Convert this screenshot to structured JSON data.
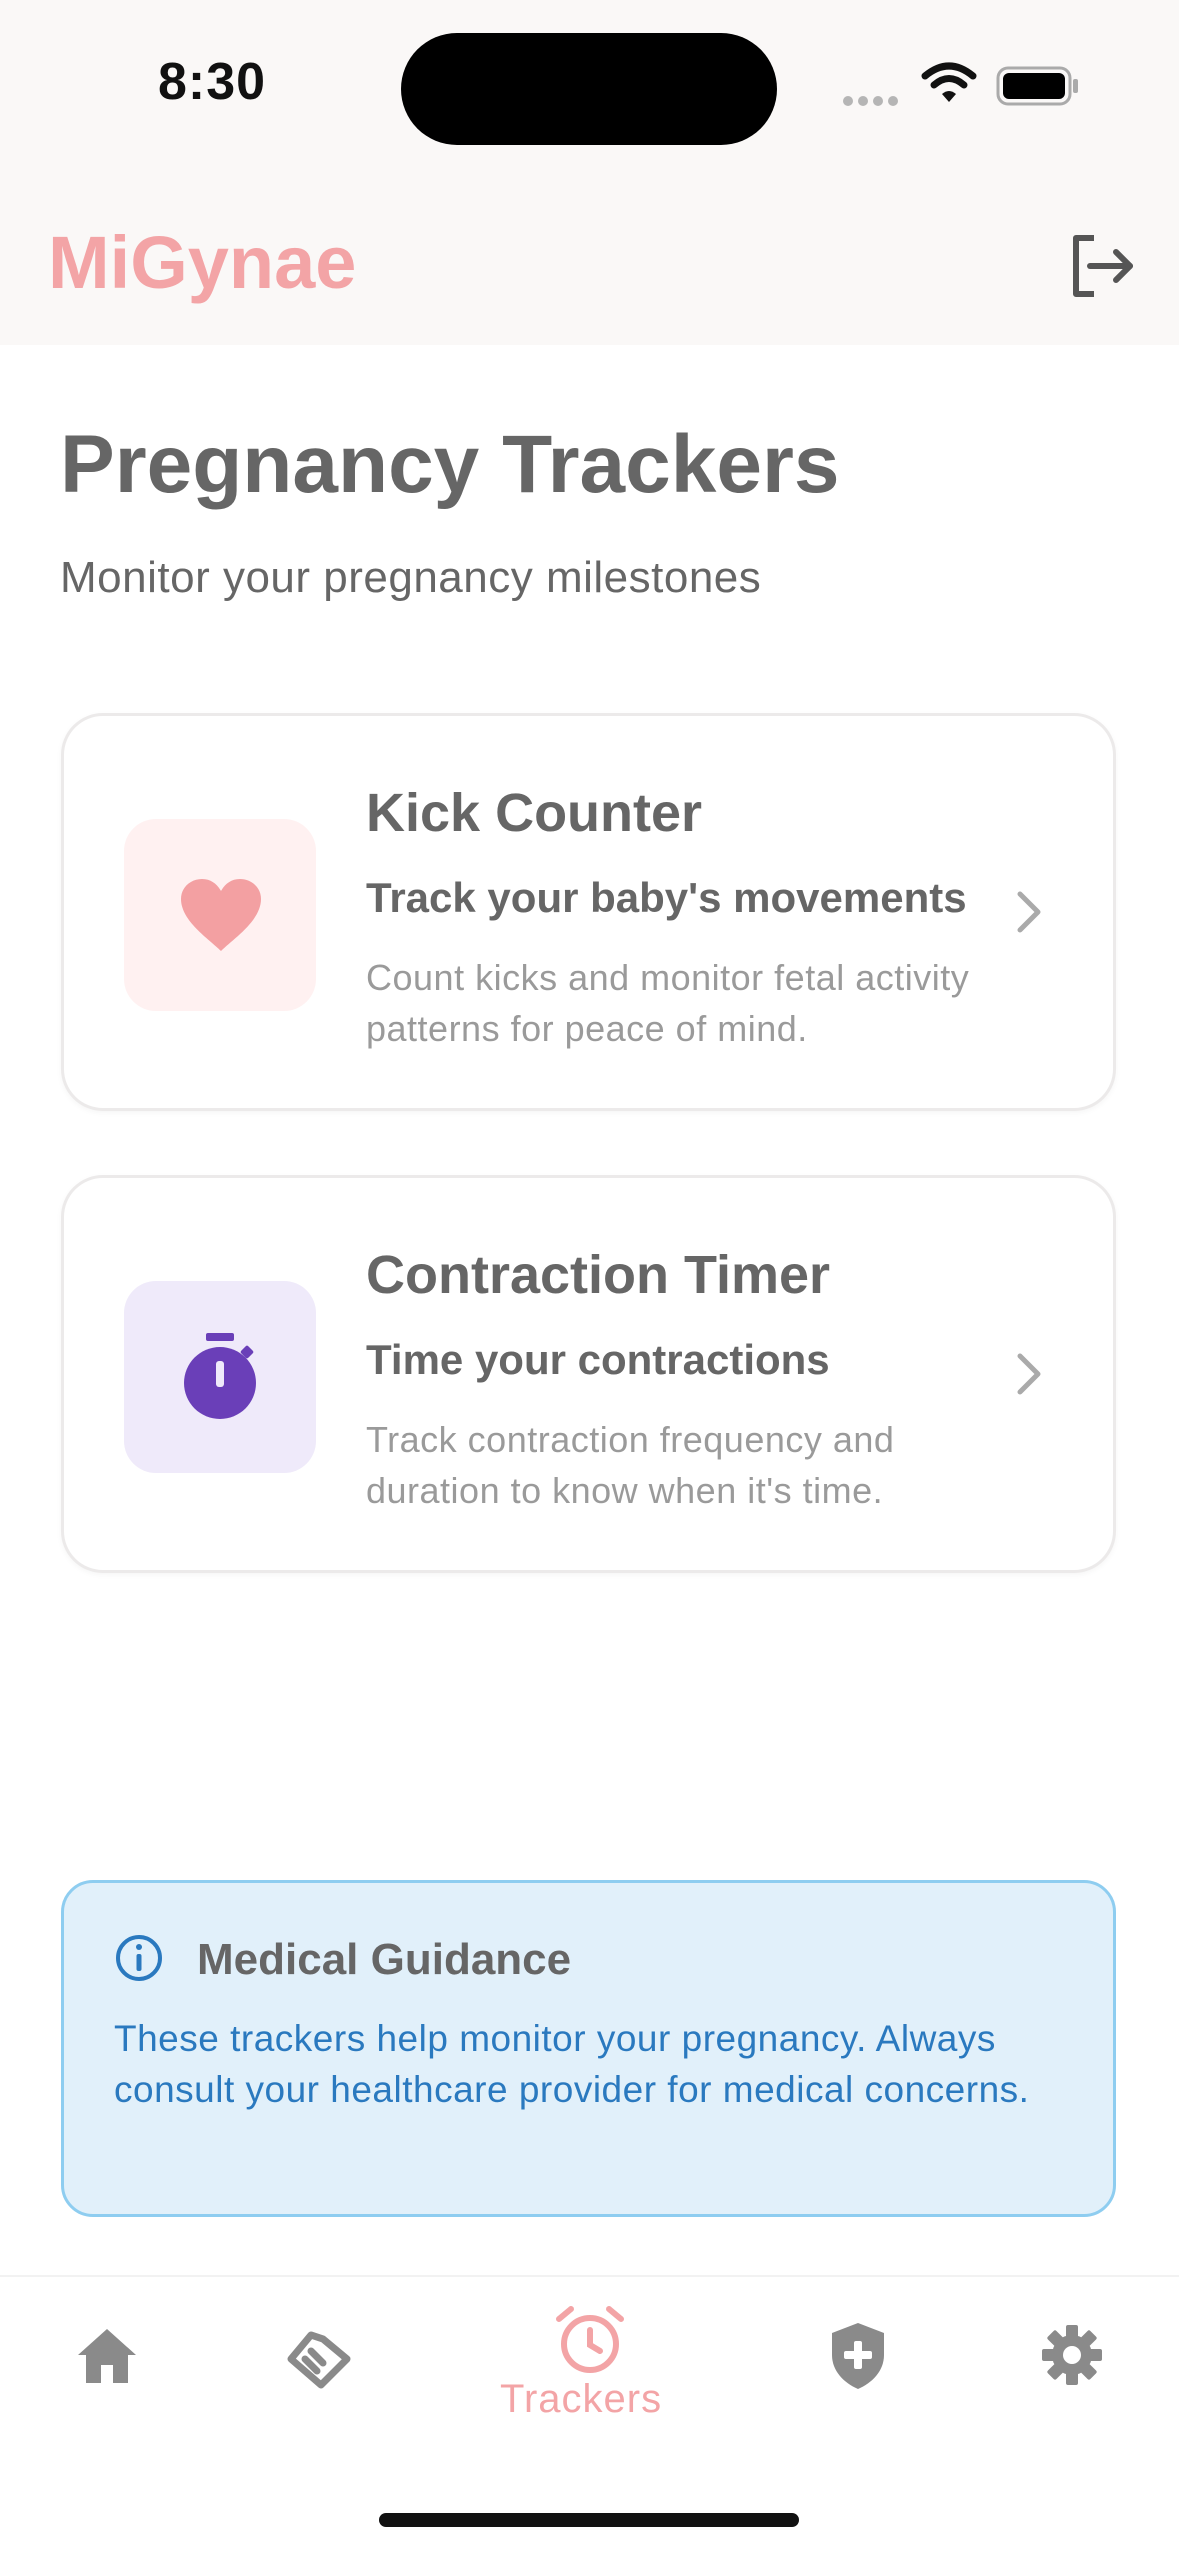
{
  "status_bar": {
    "time": "8:30"
  },
  "app_bar": {
    "title": "MiGynae",
    "logout_icon": "logout-icon"
  },
  "header": {
    "title": "Pregnancy Trackers",
    "subtitle": "Monitor your pregnancy milestones"
  },
  "trackers": [
    {
      "title": "Kick Counter",
      "subtitle": "Track your baby's movements",
      "description": "Count kicks and monitor fetal activity patterns for peace of mind.",
      "icon": "heart-icon",
      "icon_color": "#f3a0a2",
      "icon_bg": "#fff1f1"
    },
    {
      "title": "Contraction Timer",
      "subtitle": "Time your contractions",
      "description": "Track contraction frequency and duration to know when it's time.",
      "icon": "stopwatch-icon",
      "icon_color": "#6a3fb8",
      "icon_bg": "#efeafa"
    }
  ],
  "info": {
    "title": "Medical Guidance",
    "text": "These trackers help monitor your pregnancy. Always consult your healthcare provider for medical concerns."
  },
  "bottom_nav": {
    "items": [
      {
        "icon": "home-icon"
      },
      {
        "icon": "handshake-icon"
      },
      {
        "icon": "alarm-icon",
        "label": "Trackers",
        "active": true
      },
      {
        "icon": "shield-plus-icon"
      },
      {
        "icon": "gear-icon"
      }
    ]
  },
  "colors": {
    "brand": "#f3a4a6",
    "text": "#666666",
    "muted": "#9a9a9a",
    "info_bg": "#e1f0fa",
    "info_border": "#8ecdf0",
    "info_text": "#2a79bf",
    "nav_inactive": "#8a8a8a"
  }
}
